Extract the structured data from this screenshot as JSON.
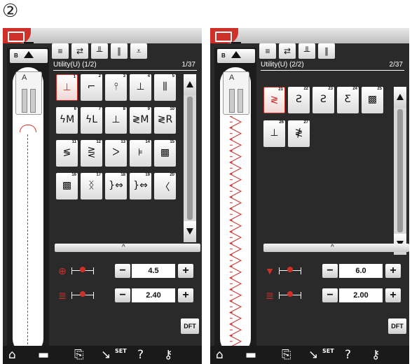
{
  "step_marker": "②",
  "colors": {
    "accent": "#d0302a",
    "panel": "#2a2a2a",
    "button": "#e6e6e6"
  },
  "screens": [
    {
      "category_label": "Utility(U) (1/2)",
      "pattern_number": "1/37",
      "patterns": [
        {
          "num": "1",
          "sym": "⊥",
          "selected": true
        },
        {
          "num": "2",
          "sym": "⌐"
        },
        {
          "num": "3",
          "sym": "⫯"
        },
        {
          "num": "4",
          "sym": "⊥"
        },
        {
          "num": "5",
          "sym": "⫼"
        },
        {
          "num": "6",
          "sym": "ϟM"
        },
        {
          "num": "7",
          "sym": "ϟL"
        },
        {
          "num": "8",
          "sym": "⊥"
        },
        {
          "num": "9",
          "sym": "≷M"
        },
        {
          "num": "10",
          "sym": "≷R"
        },
        {
          "num": "11",
          "sym": "≶"
        },
        {
          "num": "12",
          "sym": "⋛"
        },
        {
          "num": "13",
          "sym": "ᐳ"
        },
        {
          "num": "14",
          "sym": "⊧"
        },
        {
          "num": "15",
          "sym": "▩"
        },
        {
          "num": "16",
          "sym": "▩"
        },
        {
          "num": "17",
          "sym": "ᛝ"
        },
        {
          "num": "18",
          "sym": "}⇔"
        },
        {
          "num": "19",
          "sym": "}⇔"
        },
        {
          "num": "20",
          "sym": "〈"
        }
      ],
      "settings": [
        {
          "icon": "⊕",
          "value": "4.5"
        },
        {
          "icon": "≣",
          "value": "2.40"
        }
      ],
      "dft_label": "DFT"
    },
    {
      "category_label": "Utility(U) (2/2)",
      "pattern_number": "2/37",
      "patterns": [
        {
          "num": "21",
          "sym": "≷",
          "selected": true
        },
        {
          "num": "22",
          "sym": "Ƨ"
        },
        {
          "num": "23",
          "sym": "Ƨ"
        },
        {
          "num": "24",
          "sym": "Ƹ"
        },
        {
          "num": "25",
          "sym": "▩"
        },
        {
          "num": "26",
          "sym": "⊥"
        },
        {
          "num": "27",
          "sym": "≹"
        }
      ],
      "settings": [
        {
          "icon": "▼",
          "value": "6.0"
        },
        {
          "icon": "≣",
          "value": "2.00"
        }
      ],
      "dft_label": "DFT"
    }
  ],
  "bottom_bar": {
    "set_label": "SET",
    "help_label": "?"
  }
}
